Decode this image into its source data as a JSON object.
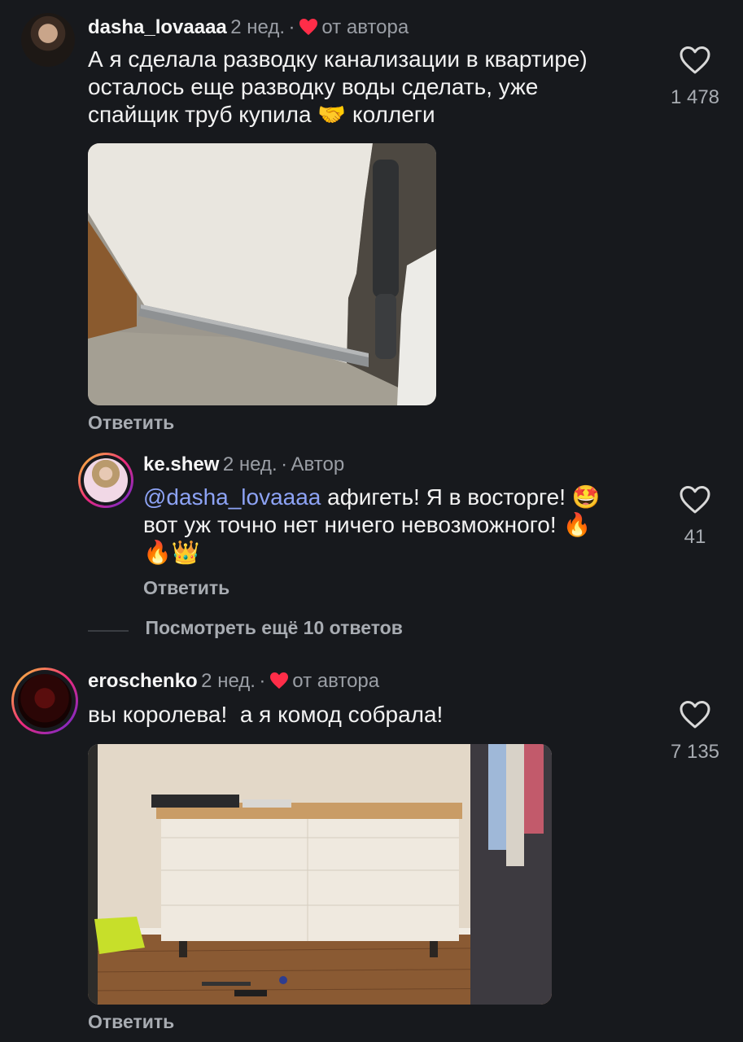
{
  "comments": [
    {
      "username": "dasha_lovaaaa",
      "time": "2 нед.",
      "separator": "·",
      "author_like_label": "от автора",
      "text_lines": [
        "А я сделала разводку канализации в квартире)",
        "осталось еще разводку воды сделать, уже",
        "спайщик труб купила"
      ],
      "text_tail": "коллеги",
      "emoji": "🤝",
      "likes": "1 478",
      "reply_label": "Ответить"
    },
    {
      "username": "ke.shew",
      "time": "2 нед.",
      "separator": "·",
      "author_label": "Автор",
      "mention": "@dasha_lovaaaa",
      "text_line1": " афигеть! Я в восторге!",
      "emoji1": "🤩",
      "text_line2": "вот уж точно нет ничего невозможного!",
      "emoji2": "🔥",
      "emoji3": "🔥👑",
      "likes": "41",
      "reply_label": "Ответить"
    },
    {
      "username": "eroschenko",
      "time": "2 нед.",
      "separator": "·",
      "author_like_label": "от автора",
      "text": "вы королева!  а я комод собрала!",
      "likes": "7 135",
      "reply_label": "Ответить"
    }
  ],
  "view_more_replies": "Посмотреть ещё 10 ответов",
  "colors": {
    "background": "#17191d",
    "author_heart": "#ff2d48",
    "mention": "#8da3f5"
  },
  "icons": {
    "like": "heart-outline-icon",
    "author_like": "heart-filled-icon"
  }
}
